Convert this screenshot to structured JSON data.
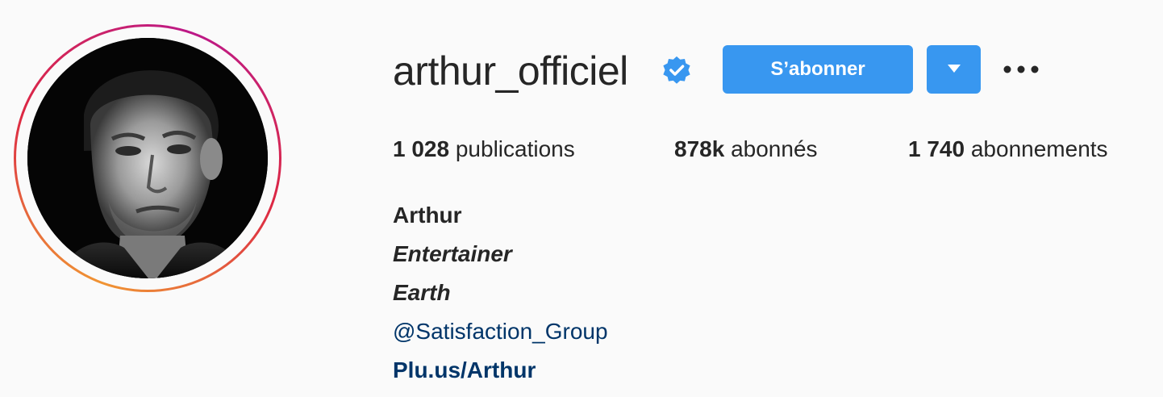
{
  "profile": {
    "username": "arthur_officiel",
    "verified_icon": "verified-badge-icon",
    "follow_label": "S’abonner",
    "dropdown_icon": "caret-down-icon",
    "more_icon": "more-options-icon",
    "accent_color": "#3897f0"
  },
  "stats": {
    "posts_count": "1 028",
    "posts_label": "publications",
    "followers_count": "878k",
    "followers_label": "abonnés",
    "following_count": "1 740",
    "following_label": "abonnements"
  },
  "bio": {
    "full_name": "Arthur",
    "line1": "Entertainer",
    "line2": "Earth",
    "mention": "@Satisfaction_Group",
    "link": "Plu.us/Arthur",
    "link_color": "#003569"
  }
}
